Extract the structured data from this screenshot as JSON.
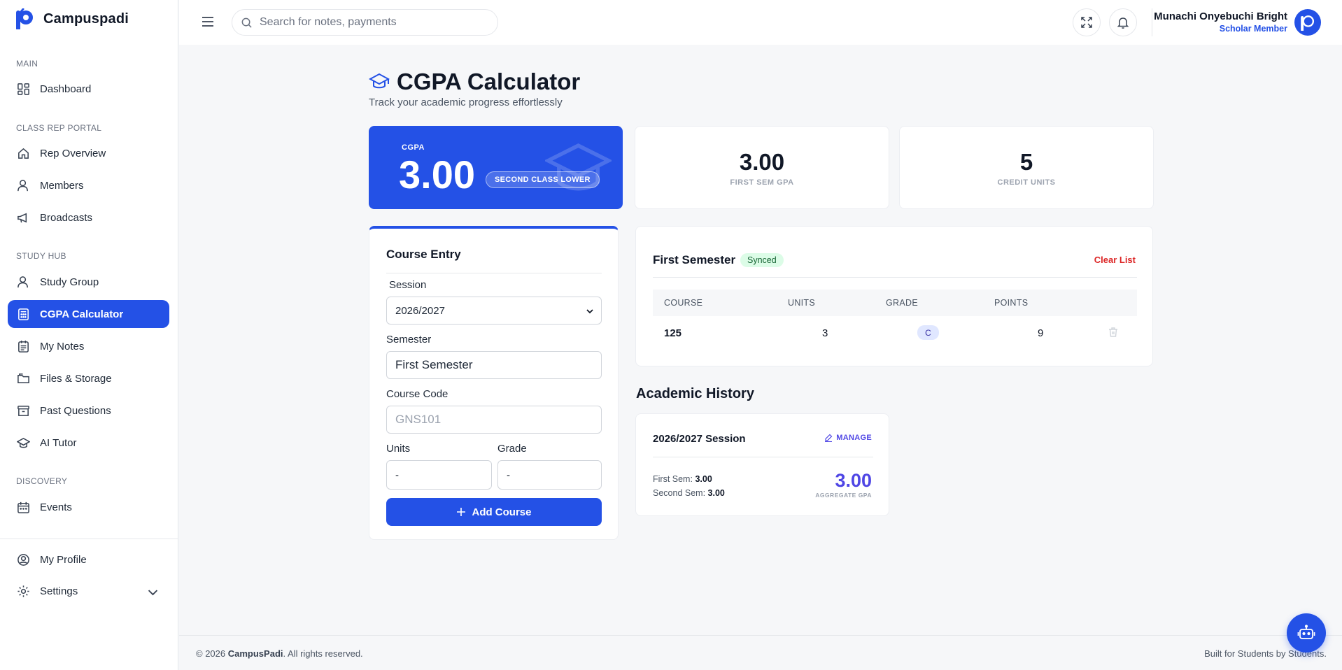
{
  "brand": {
    "name": "Campuspadi"
  },
  "sidebar": {
    "sections": {
      "main": "MAIN",
      "class_rep": "CLASS REP PORTAL",
      "study_hub": "STUDY HUB",
      "discovery": "DISCOVERY"
    },
    "items": [
      {
        "label": "Dashboard",
        "icon": "dashboard-icon"
      },
      {
        "label": "Rep Overview",
        "icon": "home-icon"
      },
      {
        "label": "Members",
        "icon": "user-icon"
      },
      {
        "label": "Broadcasts",
        "icon": "megaphone-icon"
      },
      {
        "label": "Study Group",
        "icon": "user-icon"
      },
      {
        "label": "CGPA Calculator",
        "icon": "calculator-icon",
        "active": true
      },
      {
        "label": "My Notes",
        "icon": "notes-icon"
      },
      {
        "label": "Files & Storage",
        "icon": "folder-icon"
      },
      {
        "label": "Past Questions",
        "icon": "archive-icon"
      },
      {
        "label": "AI Tutor",
        "icon": "graduation-cap-icon"
      },
      {
        "label": "Events",
        "icon": "calendar-icon"
      },
      {
        "label": "My Profile",
        "icon": "profile-icon"
      },
      {
        "label": "Settings",
        "icon": "gear-icon"
      }
    ]
  },
  "header": {
    "search_placeholder": "Search for notes, payments",
    "user_name": "Munachi Onyebuchi Bright",
    "user_role": "Scholar Member"
  },
  "page": {
    "title": "CGPA Calculator",
    "subtitle": "Track your academic progress effortlessly"
  },
  "summary": {
    "cgpa_label": "CGPA",
    "cgpa_value": "3.00",
    "class_badge": "SECOND CLASS LOWER",
    "first_sem_gpa": "3.00",
    "first_sem_gpa_label": "FIRST SEM GPA",
    "credit_units": "5",
    "credit_units_label": "CREDIT UNITS"
  },
  "entry": {
    "title": "Course Entry",
    "session_label": "Session",
    "session_value": "2026/2027",
    "semester_label": "Semester",
    "semester_value": "First Semester",
    "course_code_label": "Course Code",
    "course_code_placeholder": "GNS101",
    "units_label": "Units",
    "units_value": "-",
    "grade_label": "Grade",
    "grade_value": "-",
    "add_button": "Add Course"
  },
  "semester_table": {
    "title": "First Semester",
    "status": "Synced",
    "clear_label": "Clear List",
    "columns": [
      "COURSE",
      "UNITS",
      "GRADE",
      "POINTS"
    ],
    "rows": [
      {
        "course": "125",
        "units": "3",
        "grade": "C",
        "points": "9"
      }
    ]
  },
  "history": {
    "title": "Academic History",
    "session": "2026/2027 Session",
    "manage_label": "MANAGE",
    "first_sem_label": "First Sem:",
    "first_sem_value": "3.00",
    "second_sem_label": "Second Sem:",
    "second_sem_value": "3.00",
    "aggregate_value": "3.00",
    "aggregate_label": "AGGREGATE GPA"
  },
  "footer": {
    "copyright_prefix": "© 2026",
    "copyright_brand": "CampusPadi",
    "copyright_suffix": ". All rights reserved.",
    "tagline": "Built for Students by Students."
  },
  "colors": {
    "accent": "#2451e6",
    "indigo": "#4f46e5",
    "danger": "#dc2626",
    "success_bg": "#dcfce7"
  }
}
